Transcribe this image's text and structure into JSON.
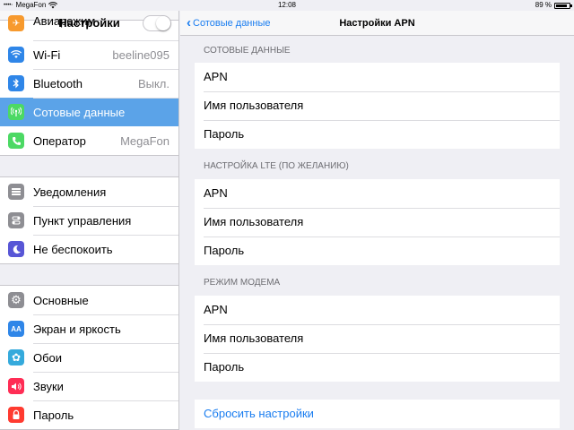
{
  "status_bar": {
    "signal": "••••◦",
    "carrier": "MegaFon",
    "time": "12:08",
    "battery_text": "89 %",
    "battery_level": 0.89
  },
  "left_panel": {
    "title": "Настройки",
    "group1": [
      {
        "label": "Авиарежим",
        "icon": "airplane-icon",
        "color": "#f79a2e",
        "toggle": true
      },
      {
        "label": "Wi-Fi",
        "icon": "wifi-icon",
        "color": "#2f86e8",
        "value": "beeline095"
      },
      {
        "label": "Bluetooth",
        "icon": "bluetooth-icon",
        "color": "#2f86e8",
        "value": "Выкл."
      },
      {
        "label": "Сотовые данные",
        "icon": "cellular-icon",
        "color": "#4cd964",
        "selected": true
      },
      {
        "label": "Оператор",
        "icon": "phone-icon",
        "color": "#4cd964",
        "value": "MegaFon"
      }
    ],
    "group2": [
      {
        "label": "Уведомления",
        "icon": "notifications-icon",
        "color": "#8e8e93"
      },
      {
        "label": "Пункт управления",
        "icon": "control-center-icon",
        "color": "#8e8e93"
      },
      {
        "label": "Не беспокоить",
        "icon": "moon-icon",
        "color": "#5856d6"
      }
    ],
    "group3": [
      {
        "label": "Основные",
        "icon": "gear-icon",
        "color": "#8e8e93"
      },
      {
        "label": "Экран и яркость",
        "icon": "display-brightness-icon",
        "color": "#2f86e8"
      },
      {
        "label": "Обои",
        "icon": "wallpaper-icon",
        "color": "#35aadc"
      },
      {
        "label": "Звуки",
        "icon": "sounds-icon",
        "color": "#ff2d55"
      },
      {
        "label": "Пароль",
        "icon": "lock-icon",
        "color": "#ff3b30"
      }
    ]
  },
  "right_panel": {
    "back_label": "Сотовые данные",
    "title": "Настройки APN",
    "sections": [
      {
        "header": "СОТОВЫЕ ДАННЫЕ",
        "rows": [
          "APN",
          "Имя пользователя",
          "Пароль"
        ]
      },
      {
        "header": "НАСТРОЙКА LTE (ПО ЖЕЛАНИЮ)",
        "rows": [
          "APN",
          "Имя пользователя",
          "Пароль"
        ]
      },
      {
        "header": "РЕЖИМ МОДЕМА",
        "rows": [
          "APN",
          "Имя пользователя",
          "Пароль"
        ]
      }
    ],
    "reset_label": "Сбросить настройки"
  },
  "colors": {
    "accent": "#1a7df0",
    "selected_row": "#5ba3e8"
  }
}
